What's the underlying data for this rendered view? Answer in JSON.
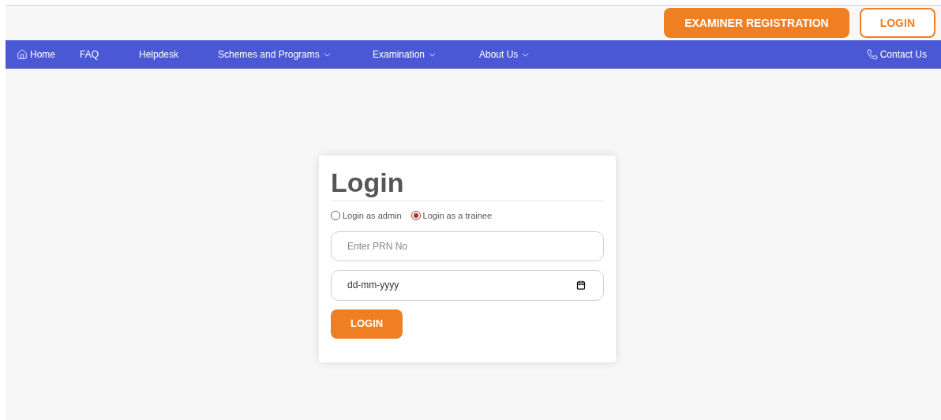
{
  "header": {
    "buttons": [
      {
        "label": "EXAMINER REGISTRATION",
        "kind": "filled"
      },
      {
        "label": "LOGIN",
        "kind": "outline"
      }
    ]
  },
  "nav": {
    "items": [
      {
        "label": "Home",
        "kind": "home"
      },
      {
        "label": "FAQ",
        "kind": "link"
      },
      {
        "label": "Helpdesk",
        "kind": "link"
      },
      {
        "label": "Schemes and Programs",
        "kind": "dropdown"
      },
      {
        "label": "Examination",
        "kind": "dropdown"
      },
      {
        "label": "About Us",
        "kind": "dropdown"
      }
    ],
    "contact": "Contact Us"
  },
  "login": {
    "title": "Login",
    "roles": [
      {
        "label": "Login as admin",
        "selected": false
      },
      {
        "label": "Login as a trainee",
        "selected": true
      }
    ],
    "prn": {
      "placeholder": "Enter PRN No"
    },
    "date": {
      "placeholder": "dd-mm-yyyy"
    },
    "submit": "LOGIN"
  }
}
